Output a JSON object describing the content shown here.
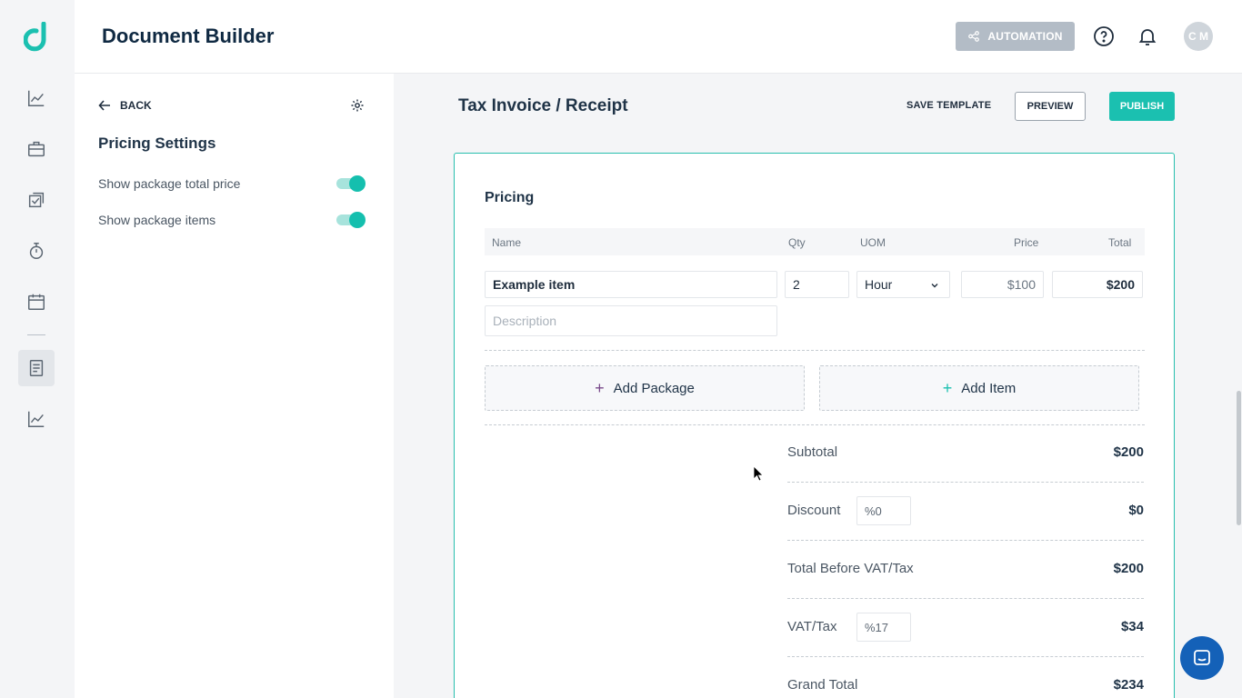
{
  "header": {
    "title": "Document Builder",
    "automation_label": "AUTOMATION",
    "avatar_initials": "C M"
  },
  "settings": {
    "back_label": "BACK",
    "title": "Pricing Settings",
    "options": [
      {
        "label": "Show package total price",
        "enabled": true
      },
      {
        "label": "Show package items",
        "enabled": true
      }
    ]
  },
  "main": {
    "title": "Tax Invoice / Receipt",
    "save_template_label": "SAVE TEMPLATE",
    "preview_label": "PREVIEW",
    "publish_label": "PUBLISH"
  },
  "pricing": {
    "section_title": "Pricing",
    "columns": {
      "name": "Name",
      "qty": "Qty",
      "uom": "UOM",
      "price": "Price",
      "total": "Total"
    },
    "item": {
      "name": "Example item",
      "qty": "2",
      "uom": "Hour",
      "price": "$100",
      "total": "$200",
      "description_placeholder": "Description"
    },
    "add_package_label": "Add Package",
    "add_item_label": "Add Item"
  },
  "summary": {
    "subtotal_label": "Subtotal",
    "subtotal_value": "$200",
    "discount_label": "Discount",
    "discount_pct": "%0",
    "discount_value": "$0",
    "before_tax_label": "Total Before VAT/Tax",
    "before_tax_value": "$200",
    "tax_label": "VAT/Tax",
    "tax_pct": "%17",
    "tax_value": "$34",
    "grand_total_label": "Grand Total",
    "grand_total_value": "$234"
  },
  "colors": {
    "accent": "#1bc0b0",
    "brand_dark": "#0f2942",
    "chat": "#1461b8"
  }
}
